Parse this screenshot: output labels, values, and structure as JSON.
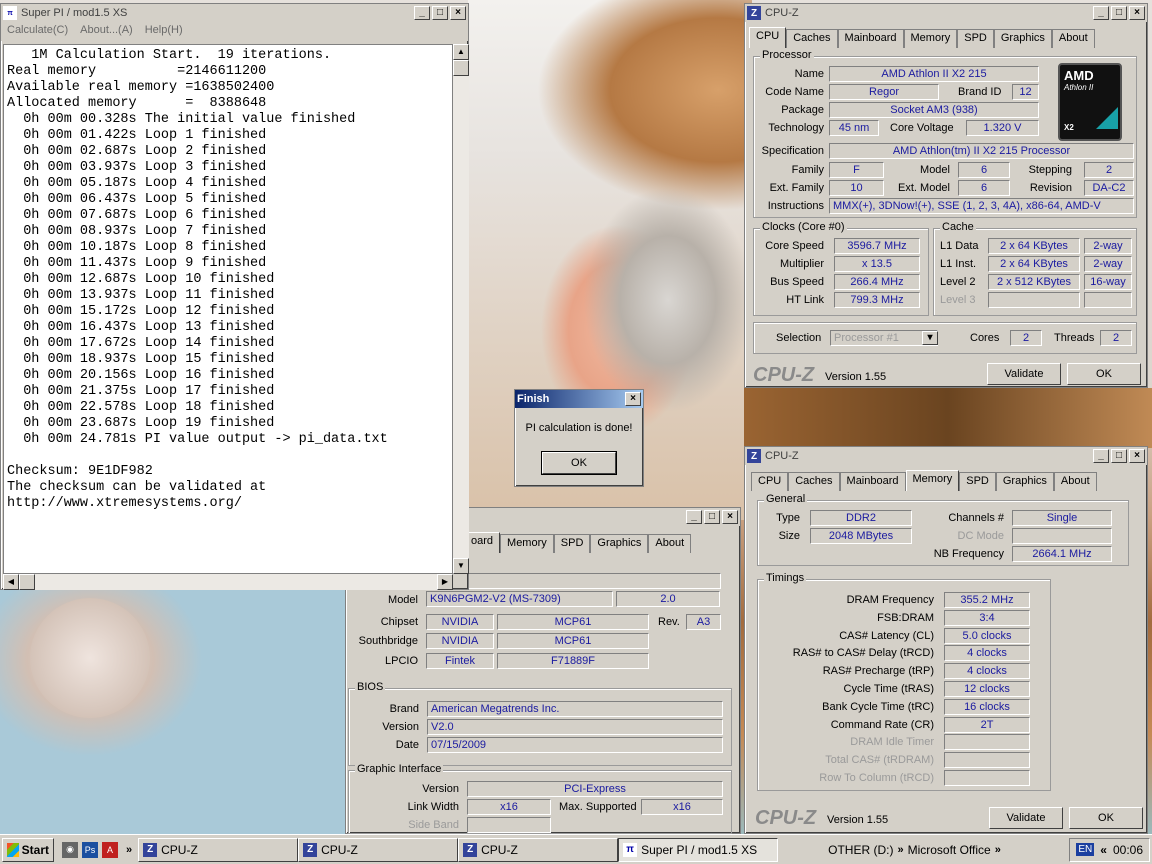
{
  "superpi": {
    "title": "Super PI / mod1.5 XS",
    "menus": [
      "Calculate(C)",
      "About...(A)",
      "Help(H)"
    ],
    "lines": [
      "   1M Calculation Start.  19 iterations.",
      "Real memory          =2146611200",
      "Available real memory =1638502400",
      "Allocated memory      =  8388648",
      "  0h 00m 00.328s The initial value finished",
      "  0h 00m 01.422s Loop 1 finished",
      "  0h 00m 02.687s Loop 2 finished",
      "  0h 00m 03.937s Loop 3 finished",
      "  0h 00m 05.187s Loop 4 finished",
      "  0h 00m 06.437s Loop 5 finished",
      "  0h 00m 07.687s Loop 6 finished",
      "  0h 00m 08.937s Loop 7 finished",
      "  0h 00m 10.187s Loop 8 finished",
      "  0h 00m 11.437s Loop 9 finished",
      "  0h 00m 12.687s Loop 10 finished",
      "  0h 00m 13.937s Loop 11 finished",
      "  0h 00m 15.172s Loop 12 finished",
      "  0h 00m 16.437s Loop 13 finished",
      "  0h 00m 17.672s Loop 14 finished",
      "  0h 00m 18.937s Loop 15 finished",
      "  0h 00m 20.156s Loop 16 finished",
      "  0h 00m 21.375s Loop 17 finished",
      "  0h 00m 22.578s Loop 18 finished",
      "  0h 00m 23.687s Loop 19 finished",
      "  0h 00m 24.781s PI value output -> pi_data.txt",
      "",
      "Checksum: 9E1DF982",
      "The checksum can be validated at",
      "http://www.xtremesystems.org/"
    ]
  },
  "dialog": {
    "title": "Finish",
    "message": "PI calculation is done!",
    "ok": "OK"
  },
  "cpuz_cpu": {
    "title": "CPU-Z",
    "tabs": [
      "CPU",
      "Caches",
      "Mainboard",
      "Memory",
      "SPD",
      "Graphics",
      "About"
    ],
    "processor": {
      "group": "Processor",
      "name_l": "Name",
      "name": "AMD Athlon II X2 215",
      "codename_l": "Code Name",
      "codename": "Regor",
      "brandid_l": "Brand ID",
      "brandid": "12",
      "package_l": "Package",
      "package": "Socket AM3 (938)",
      "tech_l": "Technology",
      "tech": "45 nm",
      "voltage_l": "Core Voltage",
      "voltage": "1.320 V",
      "spec_l": "Specification",
      "spec": "AMD Athlon(tm) II X2 215 Processor",
      "family_l": "Family",
      "family": "F",
      "model_l": "Model",
      "model": "6",
      "stepping_l": "Stepping",
      "stepping": "2",
      "extfamily_l": "Ext. Family",
      "extfamily": "10",
      "extmodel_l": "Ext. Model",
      "extmodel": "6",
      "revision_l": "Revision",
      "revision": "DA-C2",
      "instr_l": "Instructions",
      "instr": "MMX(+), 3DNow!(+), SSE (1, 2, 3, 4A), x86-64, AMD-V"
    },
    "logo": {
      "brand": "AMD",
      "line": "Athlon II",
      "sub": "X2"
    },
    "clocks": {
      "group": "Clocks (Core #0)",
      "speed_l": "Core Speed",
      "speed": "3596.7 MHz",
      "mult_l": "Multiplier",
      "mult": "x 13.5",
      "bus_l": "Bus Speed",
      "bus": "266.4 MHz",
      "ht_l": "HT Link",
      "ht": "799.3 MHz"
    },
    "cache": {
      "group": "Cache",
      "l1d_l": "L1 Data",
      "l1d": "2 x 64 KBytes",
      "l1d_w": "2-way",
      "l1i_l": "L1 Inst.",
      "l1i": "2 x 64 KBytes",
      "l1i_w": "2-way",
      "l2_l": "Level 2",
      "l2": "2 x 512 KBytes",
      "l2_w": "16-way",
      "l3_l": "Level 3"
    },
    "sel_l": "Selection",
    "sel": "Processor #1",
    "cores_l": "Cores",
    "cores": "2",
    "threads_l": "Threads",
    "threads": "2",
    "brand": "CPU-Z",
    "version": "Version 1.55",
    "validate": "Validate",
    "ok": "OK"
  },
  "cpuz_mb": {
    "tabs": [
      "oard",
      "Memory",
      "SPD",
      "Graphics",
      "About"
    ],
    "model_l": "Model",
    "model": "K9N6PGM2-V2 (MS-7309)",
    "model_rev": "2.0",
    "chipset_l": "Chipset",
    "chipset": "NVIDIA",
    "chipset_m": "MCP61",
    "rev_l": "Rev.",
    "rev": "A3",
    "south_l": "Southbridge",
    "south": "NVIDIA",
    "south_m": "MCP61",
    "lpcio_l": "LPCIO",
    "lpcio": "Fintek",
    "lpcio_m": "F71889F",
    "bios": {
      "group": "BIOS",
      "brand_l": "Brand",
      "brand": "American Megatrends Inc.",
      "version_l": "Version",
      "version": "V2.0",
      "date_l": "Date",
      "date": "07/15/2009"
    },
    "gi": {
      "group": "Graphic Interface",
      "version_l": "Version",
      "version": "PCI-Express",
      "lw_l": "Link Width",
      "lw": "x16",
      "ms_l": "Max. Supported",
      "ms": "x16",
      "sb_l": "Side Band"
    }
  },
  "cpuz_mem": {
    "title": "CPU-Z",
    "tabs": [
      "CPU",
      "Caches",
      "Mainboard",
      "Memory",
      "SPD",
      "Graphics",
      "About"
    ],
    "general": {
      "group": "General",
      "type_l": "Type",
      "type": "DDR2",
      "size_l": "Size",
      "size": "2048 MBytes",
      "ch_l": "Channels #",
      "ch": "Single",
      "dc_l": "DC Mode",
      "nb_l": "NB Frequency",
      "nb": "2664.1 MHz"
    },
    "timings": {
      "group": "Timings",
      "rows": [
        {
          "l": "DRAM Frequency",
          "v": "355.2 MHz"
        },
        {
          "l": "FSB:DRAM",
          "v": "3:4"
        },
        {
          "l": "CAS# Latency (CL)",
          "v": "5.0 clocks"
        },
        {
          "l": "RAS# to CAS# Delay (tRCD)",
          "v": "4 clocks"
        },
        {
          "l": "RAS# Precharge (tRP)",
          "v": "4 clocks"
        },
        {
          "l": "Cycle Time (tRAS)",
          "v": "12 clocks"
        },
        {
          "l": "Bank Cycle Time (tRC)",
          "v": "16 clocks"
        },
        {
          "l": "Command Rate (CR)",
          "v": "2T"
        },
        {
          "l": "DRAM Idle Timer",
          "v": ""
        },
        {
          "l": "Total CAS# (tRDRAM)",
          "v": ""
        },
        {
          "l": "Row To Column (tRCD)",
          "v": ""
        }
      ]
    },
    "brand": "CPU-Z",
    "version": "Version 1.55",
    "validate": "Validate",
    "ok": "OK"
  },
  "taskbar": {
    "start": "Start",
    "tasks": [
      "CPU-Z",
      "CPU-Z",
      "CPU-Z",
      "Super PI / mod1.5 XS"
    ],
    "drive": "OTHER (D:)",
    "office": "Microsoft Office",
    "lang": "EN",
    "clock": "00:06"
  }
}
